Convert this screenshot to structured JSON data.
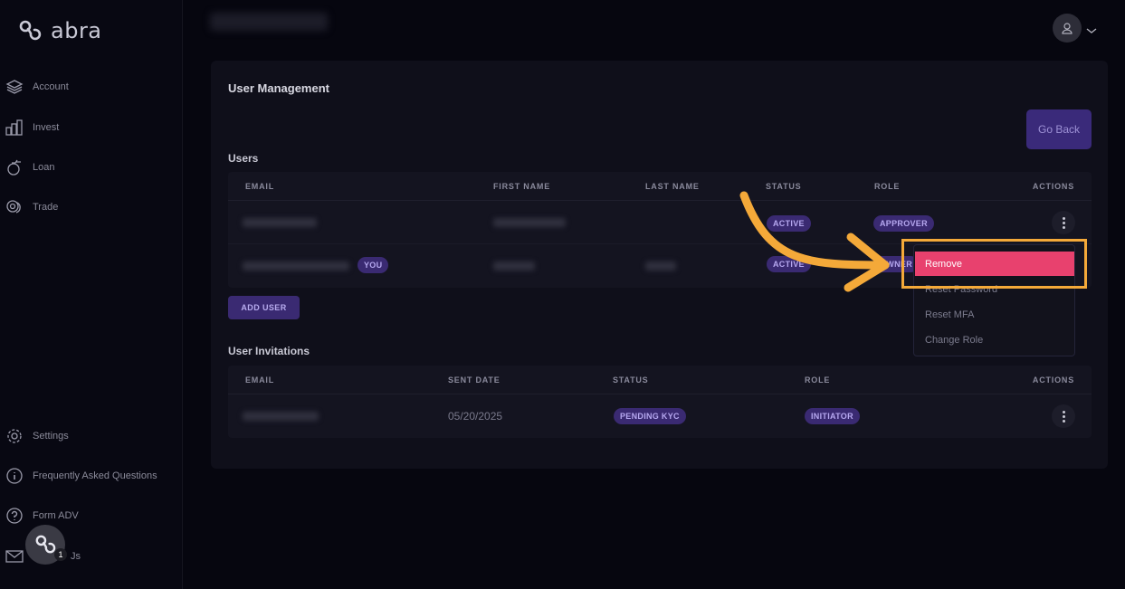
{
  "brand": {
    "name": "abra"
  },
  "sidebar": {
    "items": [
      {
        "label": "Account",
        "icon": "layers-icon"
      },
      {
        "label": "Invest",
        "icon": "bar-chart-icon"
      },
      {
        "label": "Loan",
        "icon": "money-bag-icon"
      },
      {
        "label": "Trade",
        "icon": "coins-icon"
      }
    ],
    "bottom_items": [
      {
        "label": "Settings",
        "icon": "gear-icon"
      },
      {
        "label": "Frequently Asked Questions",
        "icon": "info-icon"
      },
      {
        "label": "Form ADV",
        "icon": "question-icon"
      },
      {
        "label": "Js",
        "icon": "mail-icon"
      }
    ],
    "help_badge": "1"
  },
  "main": {
    "title": "User Management",
    "go_back_label": "Go Back",
    "users_label": "Users",
    "users_table": {
      "headers": [
        "EMAIL",
        "FIRST NAME",
        "LAST NAME",
        "STATUS",
        "ROLE",
        "ACTIONS"
      ],
      "rows": [
        {
          "status": "ACTIVE",
          "role": "APPROVER"
        },
        {
          "you_badge": "YOU",
          "status": "ACTIVE",
          "role": "OWNER"
        }
      ]
    },
    "add_user_label": "ADD USER",
    "invitations_label": "User Invitations",
    "invitations_table": {
      "headers": [
        "EMAIL",
        "SENT DATE",
        "STATUS",
        "ROLE",
        "ACTIONS"
      ],
      "rows": [
        {
          "sent_date": "05/20/2025",
          "status": "PENDING KYC",
          "role": "INITIATOR"
        }
      ]
    }
  },
  "menu": {
    "items": [
      "Remove",
      "Reset Password",
      "Reset MFA",
      "Change Role"
    ]
  },
  "colors": {
    "accent": "#3a2a72",
    "highlight": "#f4a939",
    "remove": "#e8416e"
  }
}
